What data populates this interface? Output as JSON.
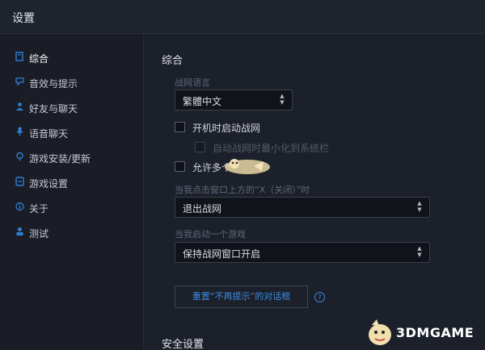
{
  "window": {
    "title": "设置"
  },
  "sidebar": {
    "items": [
      {
        "label": "综合",
        "icon": "gear-icon",
        "active": true
      },
      {
        "label": "音效与提示",
        "icon": "speaker-icon"
      },
      {
        "label": "好友与聊天",
        "icon": "friends-icon"
      },
      {
        "label": "语音聊天",
        "icon": "microphone-icon"
      },
      {
        "label": "游戏安装/更新",
        "icon": "download-icon"
      },
      {
        "label": "游戏设置",
        "icon": "game-icon"
      },
      {
        "label": "关于",
        "icon": "info-icon"
      },
      {
        "label": "测试",
        "icon": "person-icon"
      }
    ]
  },
  "main": {
    "section_title": "综合",
    "language": {
      "label": "战网语言",
      "value": "繁體中文"
    },
    "checkboxes": {
      "launch_on_startup": {
        "label": "开机时启动战网",
        "checked": false
      },
      "minimize_to_tray": {
        "label": "自动战网时最小化到系统栏",
        "checked": false,
        "disabled": true
      },
      "allow_multiple": {
        "label": "允许多个",
        "checked": false
      }
    },
    "close_behavior": {
      "label": "当我点击窗口上方的“X（关闭）”时",
      "value": "退出战网"
    },
    "game_launch": {
      "label": "当我启动一个游戏",
      "value": "保持战网窗口开启"
    },
    "reset_button": {
      "label": "重置“不再提示”的对话框"
    },
    "security_title": "安全设置"
  },
  "watermark": {
    "text": "3DMGAME"
  },
  "colors": {
    "accent": "#3c8ce0",
    "background": "#1c202a",
    "sidebar": "#1a1d25"
  }
}
